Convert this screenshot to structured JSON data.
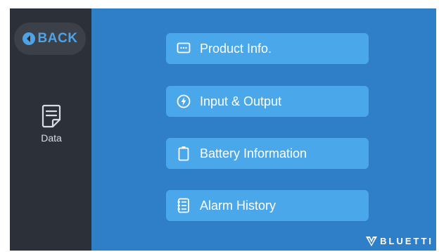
{
  "sidebar": {
    "back_label": "BACK",
    "back_icon": "back-arrow-circle-icon",
    "data_label": "Data",
    "data_icon": "document-icon"
  },
  "menu": {
    "items": [
      {
        "label": "Product Info.",
        "icon": "info-screen-icon"
      },
      {
        "label": "Input & Output",
        "icon": "lightning-circle-icon"
      },
      {
        "label": "Battery Information",
        "icon": "battery-icon"
      },
      {
        "label": "Alarm History",
        "icon": "list-document-icon"
      }
    ]
  },
  "brand": {
    "logo_text": "BLUETTI"
  },
  "colors": {
    "main_background": "#2f7ec8",
    "button_background": "#4aa7ea",
    "sidebar_background": "#2c3039",
    "accent": "#4ea3e6"
  }
}
